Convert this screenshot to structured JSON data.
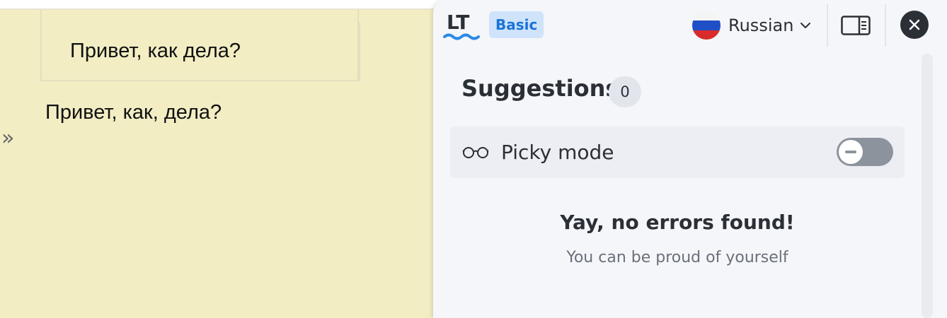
{
  "document": {
    "table_cell_text": "Привет, как дела?",
    "editor_text": "Привет, как, дела?",
    "expand_glyph": "»"
  },
  "panel": {
    "logo_text": "LT",
    "plan_badge": "Basic",
    "language": {
      "label": "Russian",
      "flag": "russia-flag-icon"
    },
    "suggestions": {
      "title": "Suggestions",
      "count": "0"
    },
    "picky_mode": {
      "label": "Picky mode",
      "enabled": false
    },
    "empty_state": {
      "title": "Yay, no errors found!",
      "subtitle": "You can be proud of yourself"
    },
    "icons": {
      "sidebar": "sidebar-toggle-icon",
      "close": "close-icon",
      "glasses": "glasses-icon",
      "chevron": "chevron-down-icon"
    },
    "colors": {
      "badge_bg": "#cfe3fb",
      "badge_text": "#1a73d9",
      "logo_wave": "#2a8ae6",
      "page_bg": "#f2edc3"
    }
  }
}
